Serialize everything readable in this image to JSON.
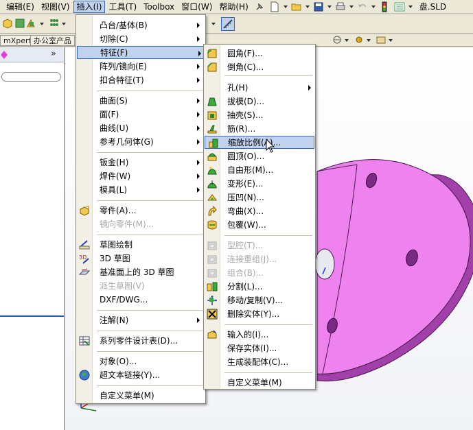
{
  "menubar": {
    "items": [
      "编辑(E)",
      "视图(V)",
      "插入(I)",
      "工具(T)",
      "Toolbox",
      "窗口(W)",
      "帮助(H)"
    ],
    "title_fragment": "盘.SLD"
  },
  "toolbar3": {
    "tab1": "mXpert",
    "tab2": "办公室产品"
  },
  "insert_menu": {
    "items": [
      {
        "label": "凸台/基体(B)",
        "has_sub": true
      },
      {
        "label": "切除(C)",
        "has_sub": true
      },
      {
        "label": "特征(F)",
        "has_sub": true,
        "highlighted": true
      },
      {
        "label": "阵列/镜向(E)",
        "has_sub": true
      },
      {
        "label": "扣合特征(T)",
        "has_sub": true
      },
      {
        "label": "曲面(S)",
        "has_sub": true
      },
      {
        "label": "面(F)",
        "has_sub": true
      },
      {
        "label": "曲线(U)",
        "has_sub": true
      },
      {
        "label": "参考几何体(G)",
        "has_sub": true
      },
      {
        "label": "钣金(H)",
        "has_sub": true
      },
      {
        "label": "焊件(W)",
        "has_sub": true
      },
      {
        "label": "模具(L)",
        "has_sub": true
      },
      {
        "label": "零件(A)…"
      },
      {
        "label": "镜向零件(M)...",
        "disabled": true
      },
      {
        "label": "草图绘制"
      },
      {
        "label": "3D 草图"
      },
      {
        "label": "基准面上的 3D 草图"
      },
      {
        "label": "派生草图(V)",
        "disabled": true
      },
      {
        "label": "DXF/DWG..."
      },
      {
        "label": "注解(N)",
        "has_sub": true
      },
      {
        "label": "系列零件设计表(D)..."
      },
      {
        "label": "对象(O)..."
      },
      {
        "label": "超文本链接(Y)..."
      },
      {
        "label": "自定义菜单(M)"
      }
    ]
  },
  "features_submenu": {
    "items": [
      {
        "label": "圆角(F)..."
      },
      {
        "label": "倒角(C)..."
      },
      {
        "label": "孔(H)",
        "has_sub": true
      },
      {
        "label": "拔模(D)..."
      },
      {
        "label": "抽壳(S)..."
      },
      {
        "label": "筋(R)..."
      },
      {
        "label": "缩放比例(A)...",
        "highlighted": true
      },
      {
        "label": "圆顶(O)..."
      },
      {
        "label": "自由形(M)..."
      },
      {
        "label": "变形(E)..."
      },
      {
        "label": "压凹(N)..."
      },
      {
        "label": "弯曲(X)..."
      },
      {
        "label": "包覆(W)..."
      },
      {
        "label": "型腔(T)...",
        "disabled": true
      },
      {
        "label": "连接重组(J)...",
        "disabled": true
      },
      {
        "label": "组合(B)...",
        "disabled": true
      },
      {
        "label": "分割(L)..."
      },
      {
        "label": "移动/复制(V)..."
      },
      {
        "label": "删除实体(Y)..."
      },
      {
        "label": "输入的(I)..."
      },
      {
        "label": "保存实体(I)..."
      },
      {
        "label": "生成装配体(C)..."
      },
      {
        "label": "自定义菜单(M)"
      }
    ]
  },
  "colors": {
    "part_face": "#ee82ee",
    "part_dark": "#a040a8",
    "highlight": "#c1d2ee",
    "highlight_border": "#316ac5"
  }
}
